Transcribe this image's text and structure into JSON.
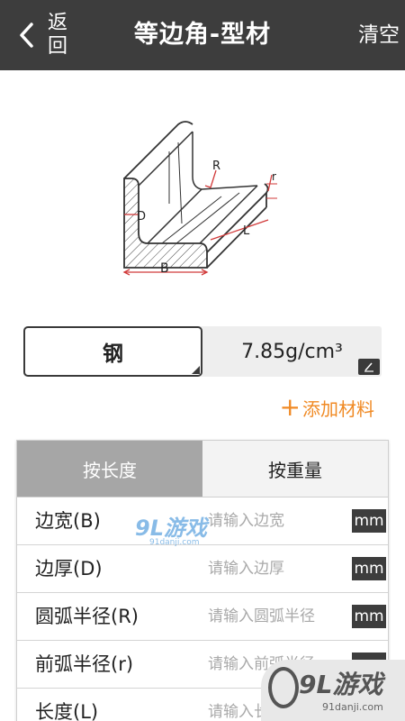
{
  "header": {
    "back_label": "返回",
    "title": "等边角-型材",
    "clear_label": "清空"
  },
  "diagram": {
    "labels": {
      "R": "R",
      "r": "r",
      "D": "D",
      "L": "L",
      "B": "B"
    },
    "accent_color": "#d13a3a"
  },
  "material": {
    "name": "钢",
    "density": "7.85g/cm³",
    "add_label": "添加材料",
    "add_color": "#f08a24"
  },
  "tabs": [
    {
      "label": "按长度",
      "active": true
    },
    {
      "label": "按重量",
      "active": false
    }
  ],
  "fields": [
    {
      "label": "边宽(B)",
      "placeholder": "请输入边宽",
      "unit": "mm"
    },
    {
      "label": "边厚(D)",
      "placeholder": "请输入边厚",
      "unit": "mm"
    },
    {
      "label": "圆弧半径(R)",
      "placeholder": "请输入圆弧半径",
      "unit": "mm"
    },
    {
      "label": "前弧半径(r)",
      "placeholder": "请输入前弧半径",
      "unit": "mm"
    },
    {
      "label": "长度(L)",
      "placeholder": "请输入长度",
      "unit": "mm"
    }
  ],
  "watermark": {
    "brand": "9L游戏",
    "url": "91danji.com"
  }
}
